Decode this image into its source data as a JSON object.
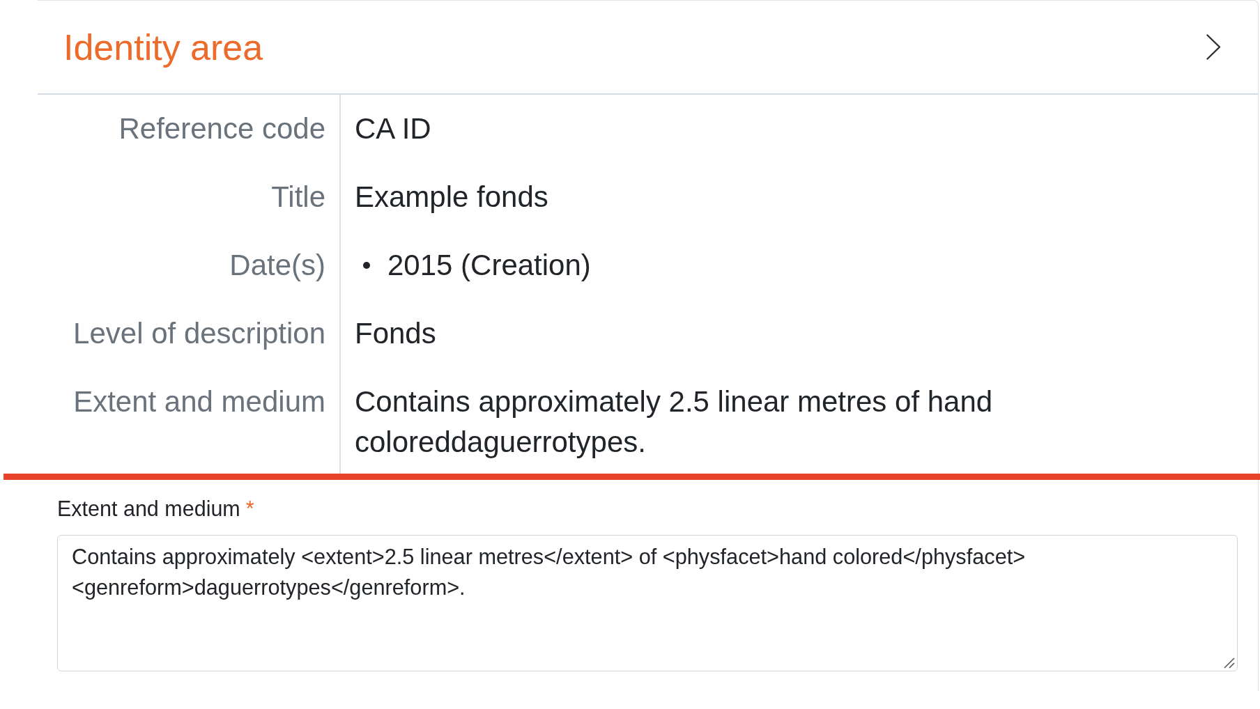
{
  "panel": {
    "title": "Identity area"
  },
  "fields": [
    {
      "label": "Reference code",
      "kind": "text",
      "value": "CA ID"
    },
    {
      "label": "Title",
      "kind": "text",
      "value": "Example fonds"
    },
    {
      "label": "Date(s)",
      "kind": "list",
      "items": [
        "2015 (Creation)"
      ]
    },
    {
      "label": "Level of description",
      "kind": "text",
      "value": "Fonds"
    },
    {
      "label": "Extent and medium",
      "kind": "text",
      "value": "Contains approximately 2.5 linear metres of hand coloreddaguerrotypes."
    }
  ],
  "editor": {
    "label": "Extent and medium",
    "required_mark": "*",
    "value": "Contains approximately <extent>2.5 linear metres</extent> of <physfacet>hand colored</physfacet> <genreform>daguerrotypes</genreform>."
  }
}
